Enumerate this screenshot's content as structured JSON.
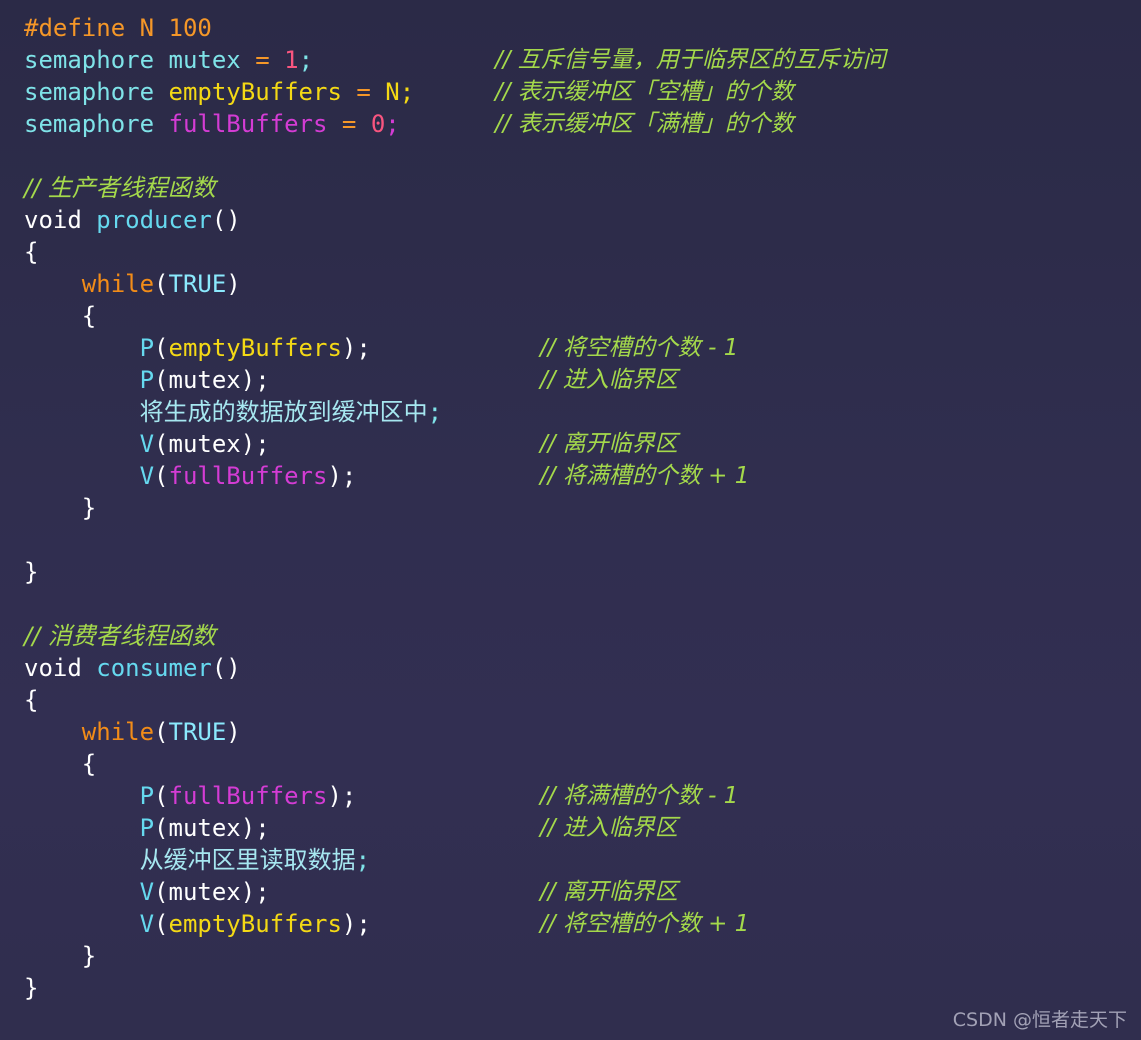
{
  "meta": {
    "language": "C (pseudocode)",
    "theme": "dark-purple",
    "colors": {
      "background_top": "#2b2a47",
      "background_bottom": "#322f52",
      "comment": "#a4d94b",
      "keyword_cyan": "#7fe3e8",
      "function_cyan": "#66d9ef",
      "flow_orange": "#f28c18",
      "preprocessor_orange": "#f59728",
      "number_pink": "#f9557f",
      "identifier_yellow": "#f4d915",
      "identifier_magenta": "#d43cd4",
      "plain_white": "#ffffff",
      "cjk_cyan": "#a6e7f0",
      "watermark": "#b6b6c8"
    }
  },
  "declarations": {
    "define": {
      "text": "#define N 100"
    },
    "mutex": {
      "keyword": "semaphore",
      "name": "mutex",
      "assign": " = ",
      "value": "1",
      "semi": ";",
      "comment": "// 互斥信号量，用于临界区的互斥访问"
    },
    "empty_buffers": {
      "keyword": "semaphore",
      "name": "emptyBuffers",
      "assign": " = ",
      "value": "N",
      "semi": ";",
      "comment": "// 表示缓冲区「空槽」的个数"
    },
    "full_buffers": {
      "keyword": "semaphore",
      "name": "fullBuffers",
      "assign": " = ",
      "value": "0",
      "semi": ";",
      "comment": "// 表示缓冲区「满槽」的个数"
    }
  },
  "producer": {
    "header_comment": "// 生产者线程函数",
    "return_type": "void",
    "name": "producer",
    "params": "()",
    "open_brace": "{",
    "loop_keyword": "while",
    "loop_open_paren": "(",
    "loop_condition": "TRUE",
    "loop_close_paren": ")",
    "loop_open_brace": "{",
    "statements": [
      {
        "call": "P",
        "open": "(",
        "arg": "emptyBuffers",
        "close": ");",
        "arg_style": "yellow",
        "comment": "// 将空槽的个数 - 1"
      },
      {
        "call": "P",
        "open": "(",
        "arg": "mutex",
        "close": ");",
        "arg_style": "plain",
        "comment": "// 进入临界区"
      },
      {
        "cjk_statement": "将生成的数据放到缓冲区中",
        "cjk_semi": ";",
        "comment": ""
      },
      {
        "call": "V",
        "open": "(",
        "arg": "mutex",
        "close": ");",
        "arg_style": "plain",
        "comment": "// 离开临界区"
      },
      {
        "call": "V",
        "open": "(",
        "arg": "fullBuffers",
        "close": ");",
        "arg_style": "magenta",
        "comment": "// 将满槽的个数 + 1"
      }
    ],
    "loop_close_brace": "}",
    "close_brace": "}"
  },
  "consumer": {
    "header_comment": "// 消费者线程函数",
    "return_type": "void",
    "name": "consumer",
    "params": "()",
    "open_brace": "{",
    "loop_keyword": "while",
    "loop_open_paren": "(",
    "loop_condition": "TRUE",
    "loop_close_paren": ")",
    "loop_open_brace": "{",
    "statements": [
      {
        "call": "P",
        "open": "(",
        "arg": "fullBuffers",
        "close": ");",
        "arg_style": "magenta",
        "comment": "// 将满槽的个数 - 1"
      },
      {
        "call": "P",
        "open": "(",
        "arg": "mutex",
        "close": ");",
        "arg_style": "plain",
        "comment": "// 进入临界区"
      },
      {
        "cjk_statement": "从缓冲区里读取数据",
        "cjk_semi": ";",
        "comment": ""
      },
      {
        "call": "V",
        "open": "(",
        "arg": "mutex",
        "close": ");",
        "arg_style": "plain",
        "comment": "// 离开临界区"
      },
      {
        "call": "V",
        "open": "(",
        "arg": "emptyBuffers",
        "close": ");",
        "arg_style": "yellow",
        "comment": "// 将空槽的个数 + 1"
      }
    ],
    "loop_close_brace": "}",
    "close_brace": "}"
  },
  "watermark": {
    "text": "CSDN @恒者走天下"
  }
}
